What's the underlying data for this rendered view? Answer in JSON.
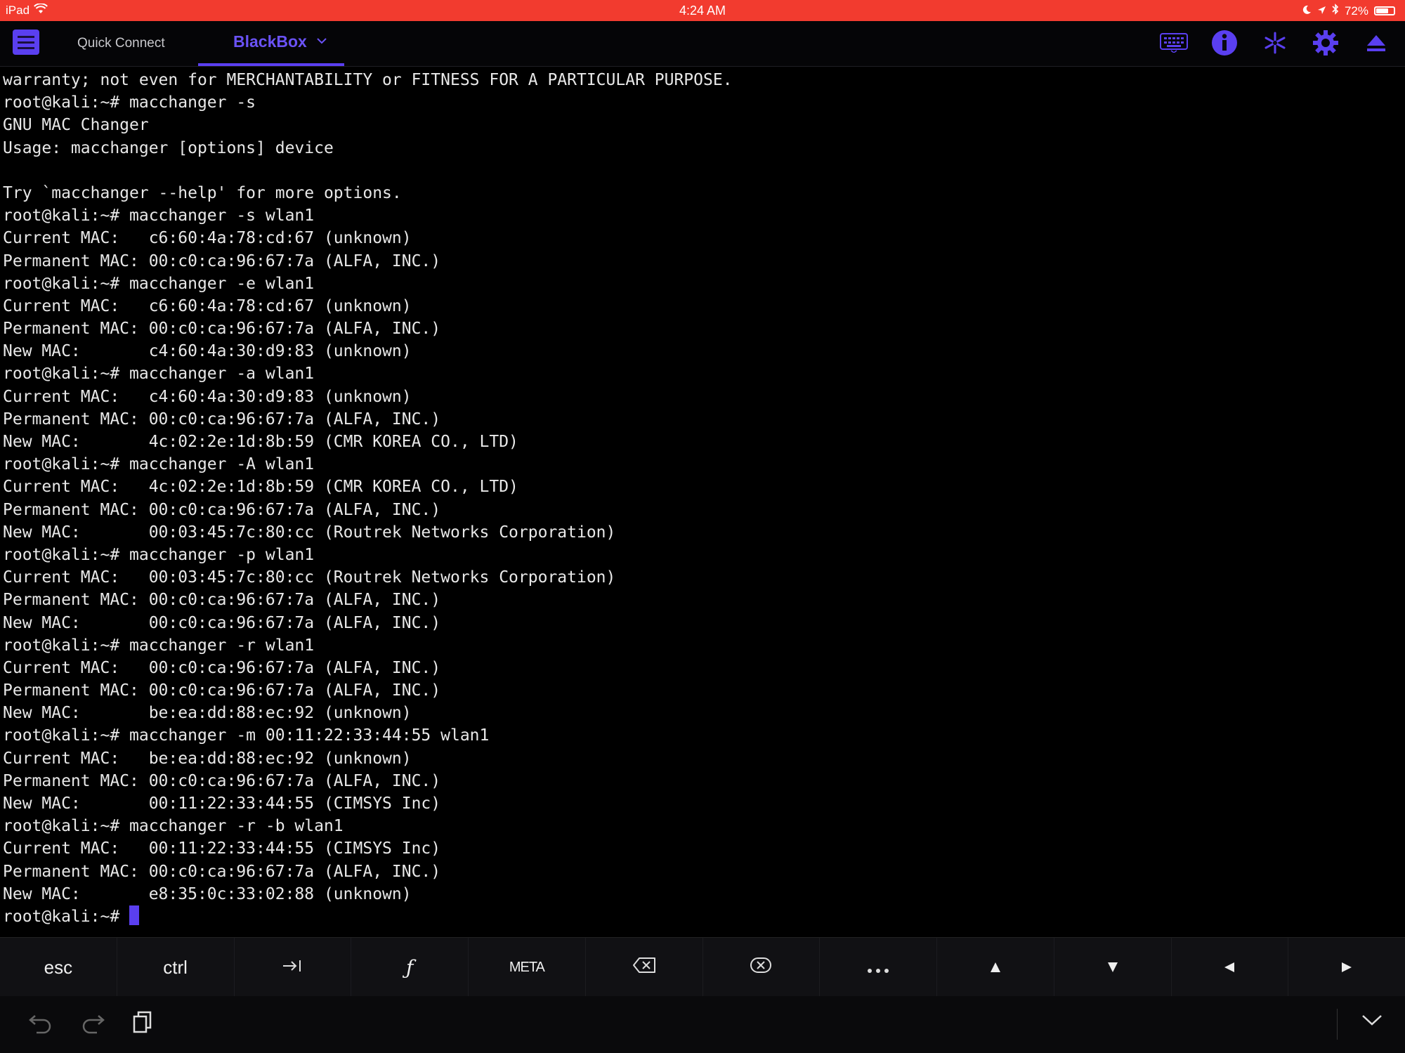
{
  "status_bar": {
    "device": "iPad",
    "time": "4:24 AM",
    "battery": "72%",
    "battery_level": 0.72
  },
  "toolbar": {
    "tabs": [
      {
        "label": "Quick Connect"
      },
      {
        "label": "BlackBox",
        "active": true
      }
    ],
    "icons": [
      "keyboard-icon",
      "info-icon",
      "snippet-icon",
      "gear-icon",
      "eject-icon"
    ]
  },
  "terminal": {
    "lines": [
      "warranty; not even for MERCHANTABILITY or FITNESS FOR A PARTICULAR PURPOSE.",
      "root@kali:~# macchanger -s",
      "GNU MAC Changer",
      "Usage: macchanger [options] device",
      "",
      "Try `macchanger --help' for more options.",
      "root@kali:~# macchanger -s wlan1",
      "Current MAC:   c6:60:4a:78:cd:67 (unknown)",
      "Permanent MAC: 00:c0:ca:96:67:7a (ALFA, INC.)",
      "root@kali:~# macchanger -e wlan1",
      "Current MAC:   c6:60:4a:78:cd:67 (unknown)",
      "Permanent MAC: 00:c0:ca:96:67:7a (ALFA, INC.)",
      "New MAC:       c4:60:4a:30:d9:83 (unknown)",
      "root@kali:~# macchanger -a wlan1",
      "Current MAC:   c4:60:4a:30:d9:83 (unknown)",
      "Permanent MAC: 00:c0:ca:96:67:7a (ALFA, INC.)",
      "New MAC:       4c:02:2e:1d:8b:59 (CMR KOREA CO., LTD)",
      "root@kali:~# macchanger -A wlan1",
      "Current MAC:   4c:02:2e:1d:8b:59 (CMR KOREA CO., LTD)",
      "Permanent MAC: 00:c0:ca:96:67:7a (ALFA, INC.)",
      "New MAC:       00:03:45:7c:80:cc (Routrek Networks Corporation)",
      "root@kali:~# macchanger -p wlan1",
      "Current MAC:   00:03:45:7c:80:cc (Routrek Networks Corporation)",
      "Permanent MAC: 00:c0:ca:96:67:7a (ALFA, INC.)",
      "New MAC:       00:c0:ca:96:67:7a (ALFA, INC.)",
      "root@kali:~# macchanger -r wlan1",
      "Current MAC:   00:c0:ca:96:67:7a (ALFA, INC.)",
      "Permanent MAC: 00:c0:ca:96:67:7a (ALFA, INC.)",
      "New MAC:       be:ea:dd:88:ec:92 (unknown)",
      "root@kali:~# macchanger -m 00:11:22:33:44:55 wlan1",
      "Current MAC:   be:ea:dd:88:ec:92 (unknown)",
      "Permanent MAC: 00:c0:ca:96:67:7a (ALFA, INC.)",
      "New MAC:       00:11:22:33:44:55 (CIMSYS Inc)",
      "root@kali:~# macchanger -r -b wlan1",
      "Current MAC:   00:11:22:33:44:55 (CIMSYS Inc)",
      "Permanent MAC: 00:c0:ca:96:67:7a (ALFA, INC.)",
      "New MAC:       e8:35:0c:33:02:88 (unknown)"
    ],
    "prompt": "root@kali:~# "
  },
  "keybar": {
    "keys": [
      {
        "label": "esc",
        "icon": ""
      },
      {
        "label": "ctrl",
        "icon": ""
      },
      {
        "label": "",
        "icon": "tab-icon"
      },
      {
        "label": "",
        "icon": "function-icon"
      },
      {
        "label": "META",
        "icon": ""
      },
      {
        "label": "",
        "icon": "backspace-icon"
      },
      {
        "label": "",
        "icon": "delete-icon"
      },
      {
        "label": "",
        "icon": "more-icon"
      },
      {
        "label": "",
        "icon": "arrow-up-icon"
      },
      {
        "label": "",
        "icon": "arrow-down-icon"
      },
      {
        "label": "",
        "icon": "arrow-left-icon"
      },
      {
        "label": "",
        "icon": "arrow-right-icon"
      }
    ]
  },
  "bottom_bar": {
    "icons": [
      "undo-icon",
      "redo-icon",
      "clipboard-icon",
      "hide-keyboard-icon"
    ]
  },
  "colors": {
    "status_bar": "#f23b2f",
    "accent": "#5a3ff0",
    "terminal_bg": "#000000",
    "terminal_fg": "#e8e8e8"
  }
}
